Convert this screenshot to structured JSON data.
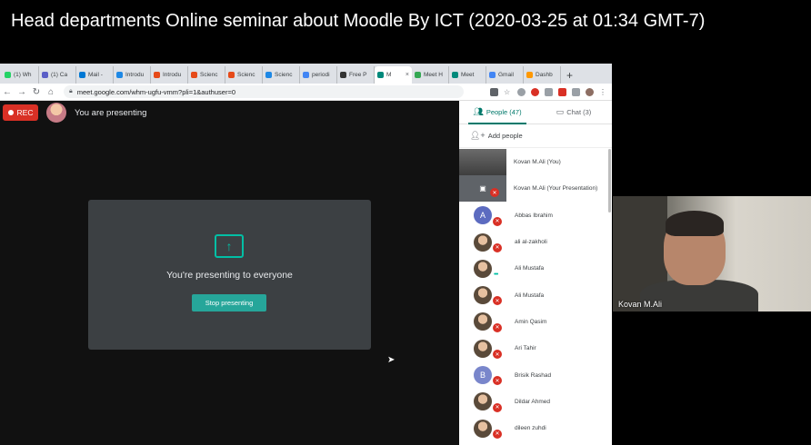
{
  "video_title": "Head departments Online seminar about Moodle By ICT (2020-03-25 at 01:34 GMT-7)",
  "browser": {
    "tabs": [
      {
        "label": "(1) Wh",
        "color": "#25d366"
      },
      {
        "label": "(1) Ca",
        "color": "#5b5fc7"
      },
      {
        "label": "Mail -",
        "color": "#0078d4"
      },
      {
        "label": "Introdu",
        "color": "#1e88e5"
      },
      {
        "label": "Introdu",
        "color": "#e64a19"
      },
      {
        "label": "Scienc",
        "color": "#e64a19"
      },
      {
        "label": "Scienc",
        "color": "#e64a19"
      },
      {
        "label": "Scienc",
        "color": "#1e88e5"
      },
      {
        "label": "periodi",
        "color": "#4285f4"
      },
      {
        "label": "Free P",
        "color": "#333333"
      },
      {
        "label": "M",
        "color": "#00897b",
        "active": true
      },
      {
        "label": "Meet H",
        "color": "#34a853"
      },
      {
        "label": "Meet",
        "color": "#00897b"
      },
      {
        "label": "Gmail",
        "color": "#4285f4"
      },
      {
        "label": "Dashb",
        "color": "#ff9800"
      }
    ],
    "new_tab_symbol": "+",
    "url": "meet.google.com/whm-ugfu-vmm?pli=1&authuser=0",
    "nav": {
      "back": "←",
      "forward": "→",
      "reload": "↻",
      "home": "⌂"
    },
    "more_symbol": "⋮"
  },
  "meet": {
    "rec_label": "REC",
    "presenting_label": "You are presenting",
    "card_text": "You're presenting to everyone",
    "stop_button": "Stop presenting",
    "people_tab": "People (47)",
    "chat_tab": "Chat (3)",
    "add_people": "Add people",
    "participants": [
      {
        "name": "Kovan M.Ali (You)",
        "avatar": "thumb",
        "status": "none"
      },
      {
        "name": "Kovan M.Ali (Your Presentation)",
        "avatar": "screen",
        "status": "muted"
      },
      {
        "name": "Abbas Ibrahim",
        "avatar": "letter",
        "letter": "A",
        "color": "#5c6bc0",
        "status": "muted"
      },
      {
        "name": "ali al-zakholi",
        "avatar": "photo",
        "status": "muted"
      },
      {
        "name": "Ali Mustafa",
        "avatar": "photo",
        "status": "talking"
      },
      {
        "name": "Ali Mustafa",
        "avatar": "photo",
        "status": "muted"
      },
      {
        "name": "Amin Qasim",
        "avatar": "photo",
        "status": "muted"
      },
      {
        "name": "Ari Tahir",
        "avatar": "photo",
        "status": "muted"
      },
      {
        "name": "Brisik Rashad",
        "avatar": "letter",
        "letter": "B",
        "color": "#7986cb",
        "status": "muted"
      },
      {
        "name": "Dildar Ahmed",
        "avatar": "photo",
        "status": "muted"
      },
      {
        "name": "dileen zuhdi",
        "avatar": "photo",
        "status": "muted"
      }
    ]
  },
  "webcam": {
    "label": "Kovan M.Ali"
  },
  "colors": {
    "accent": "#00796b",
    "rec": "#d93025",
    "button": "#26a69a"
  }
}
